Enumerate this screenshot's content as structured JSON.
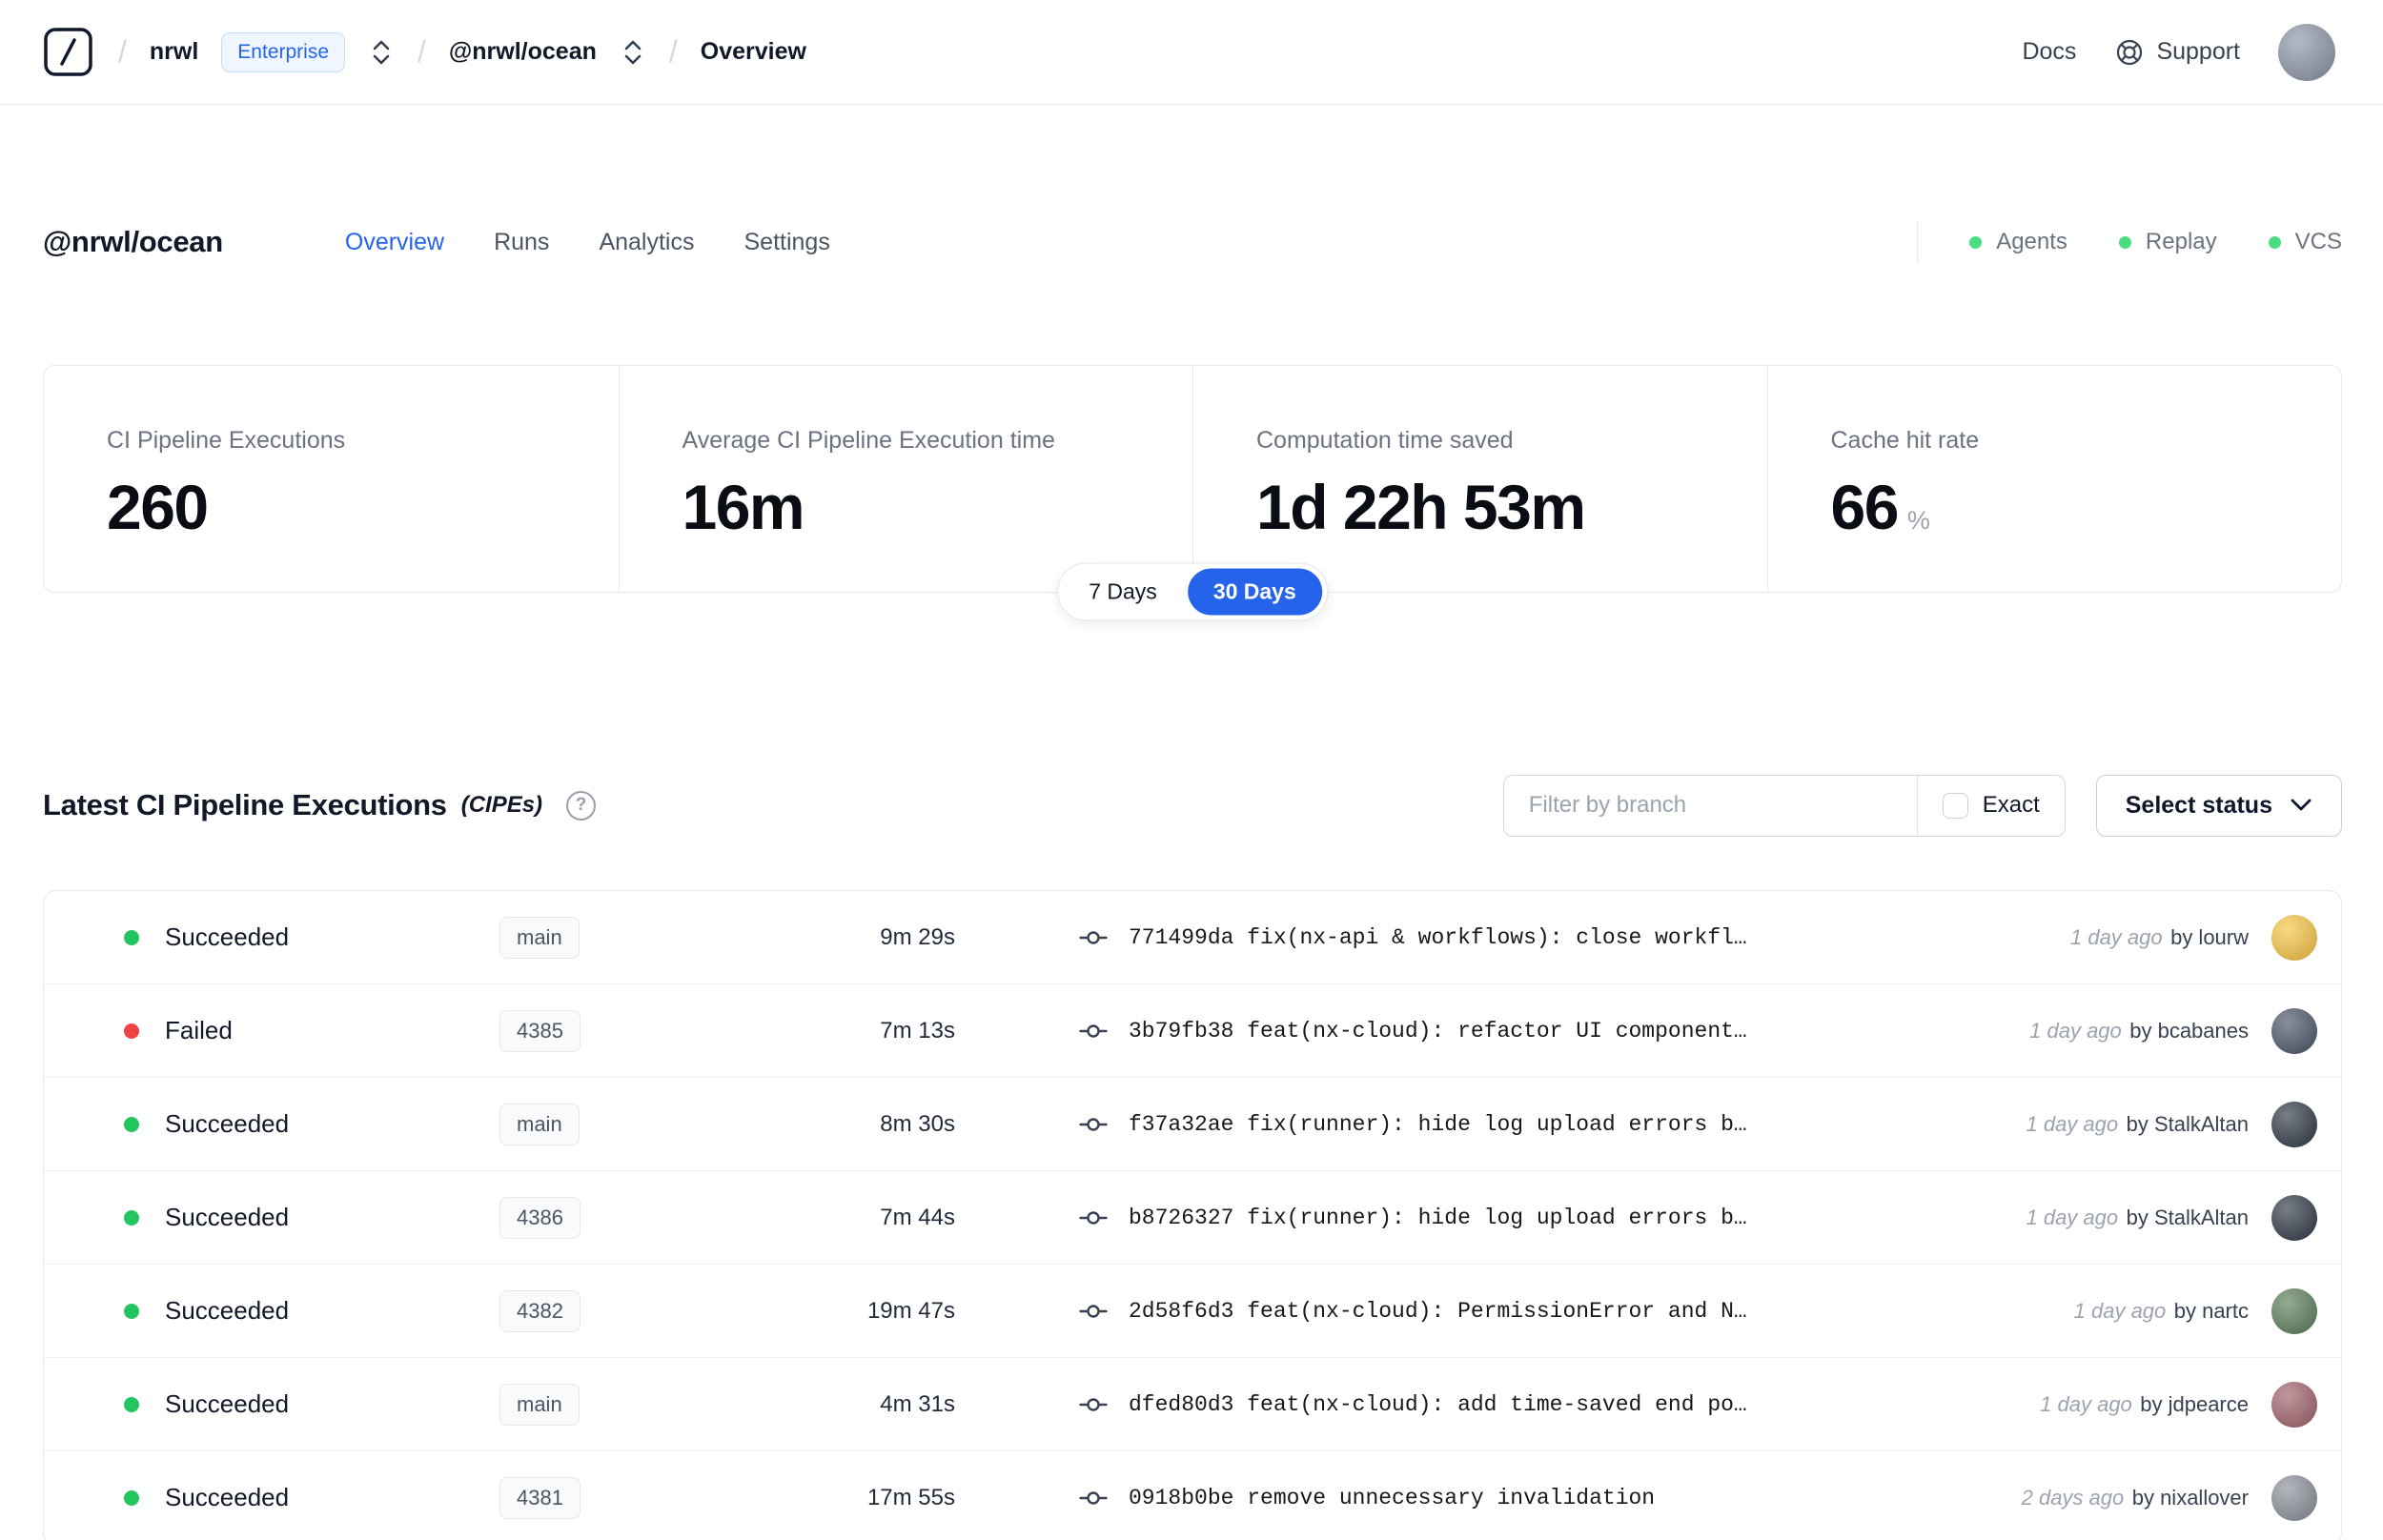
{
  "topbar": {
    "separator": "/",
    "org": "nrwl",
    "org_badge": "Enterprise",
    "workspace": "@nrwl/ocean",
    "page": "Overview",
    "docs_label": "Docs",
    "support_label": "Support"
  },
  "header": {
    "title": "@nrwl/ocean",
    "tabs": [
      {
        "label": "Overview",
        "active": true
      },
      {
        "label": "Runs",
        "active": false
      },
      {
        "label": "Analytics",
        "active": false
      },
      {
        "label": "Settings",
        "active": false
      }
    ],
    "statuses": [
      {
        "label": "Agents"
      },
      {
        "label": "Replay"
      },
      {
        "label": "VCS"
      }
    ],
    "status_dot_color": "#4ade80"
  },
  "stats": {
    "cards": [
      {
        "label": "CI Pipeline Executions",
        "value": "260",
        "suffix": ""
      },
      {
        "label": "Average CI Pipeline Execution time",
        "value": "16m",
        "suffix": ""
      },
      {
        "label": "Computation time saved",
        "value": "1d 22h 53m",
        "suffix": ""
      },
      {
        "label": "Cache hit rate",
        "value": "66",
        "suffix": "%"
      }
    ],
    "range_options": [
      {
        "label": "7 Days",
        "active": false
      },
      {
        "label": "30 Days",
        "active": true
      }
    ],
    "accent_color": "#2563eb"
  },
  "cipes": {
    "title": "Latest CI Pipeline Executions",
    "subtitle": "(CIPEs)",
    "help_glyph": "?",
    "filter": {
      "placeholder": "Filter by branch",
      "exact_label": "Exact"
    },
    "status_select_label": "Select status",
    "rows": [
      {
        "status": "Succeeded",
        "dot_color": "#22c55e",
        "branch": "main",
        "duration": "9m 29s",
        "hash": "771499da",
        "message": "fix(nx-api & workflows): close workfl…",
        "time": "1 day ago",
        "author": "by lourw",
        "avatar_color": "#f6c443"
      },
      {
        "status": "Failed",
        "dot_color": "#ef4444",
        "branch": "4385",
        "duration": "7m 13s",
        "hash": "3b79fb38",
        "message": "feat(nx-cloud): refactor UI component…",
        "time": "1 day ago",
        "author": "by bcabanes",
        "avatar_color": "#4a5568"
      },
      {
        "status": "Succeeded",
        "dot_color": "#22c55e",
        "branch": "main",
        "duration": "8m 30s",
        "hash": "f37a32ae",
        "message": "fix(runner): hide log upload errors b…",
        "time": "1 day ago",
        "author": "by StalkAltan",
        "avatar_color": "#303846"
      },
      {
        "status": "Succeeded",
        "dot_color": "#22c55e",
        "branch": "4386",
        "duration": "7m 44s",
        "hash": "b8726327",
        "message": "fix(runner): hide log upload errors b…",
        "time": "1 day ago",
        "author": "by StalkAltan",
        "avatar_color": "#303846"
      },
      {
        "status": "Succeeded",
        "dot_color": "#22c55e",
        "branch": "4382",
        "duration": "19m 47s",
        "hash": "2d58f6d3",
        "message": "feat(nx-cloud): PermissionError and N…",
        "time": "1 day ago",
        "author": "by nartc",
        "avatar_color": "#5a7d5a"
      },
      {
        "status": "Succeeded",
        "dot_color": "#22c55e",
        "branch": "main",
        "duration": "4m 31s",
        "hash": "dfed80d3",
        "message": "feat(nx-cloud): add time-saved end po…",
        "time": "1 day ago",
        "author": "by jdpearce",
        "avatar_color": "#a0606a"
      },
      {
        "status": "Succeeded",
        "dot_color": "#22c55e",
        "branch": "4381",
        "duration": "17m 55s",
        "hash": "0918b0be",
        "message": "remove unnecessary invalidation",
        "time": "2 days ago",
        "author": "by nixallover",
        "avatar_color": "#8a8f98"
      }
    ]
  }
}
